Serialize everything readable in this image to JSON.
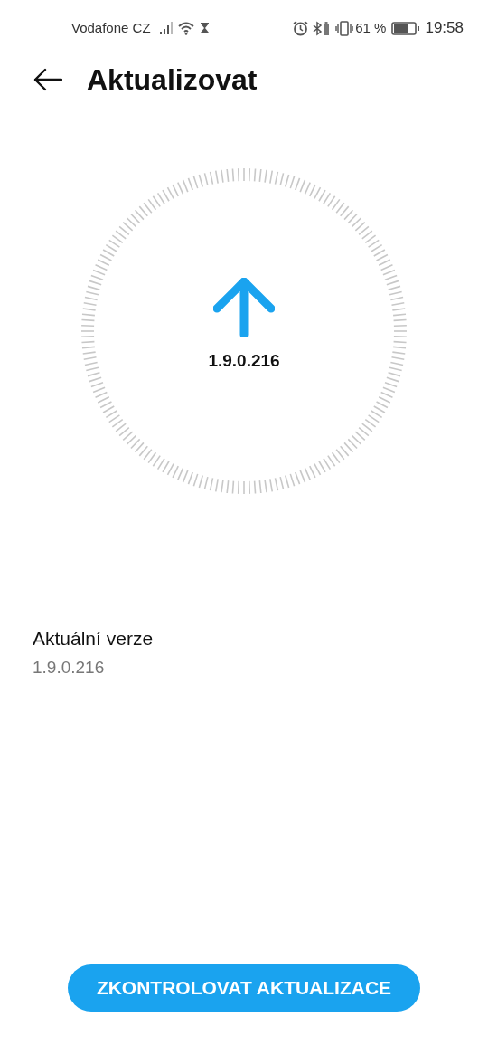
{
  "status_bar": {
    "carrier": "Vodafone CZ",
    "battery_percent": "61 %",
    "time": "19:58"
  },
  "header": {
    "title": "Aktualizovat"
  },
  "dial": {
    "version": "1.9.0.216"
  },
  "current_version": {
    "label": "Aktuální verze",
    "value": "1.9.0.216"
  },
  "button": {
    "label": "ZKONTROLOVAT AKTUALIZACE"
  }
}
